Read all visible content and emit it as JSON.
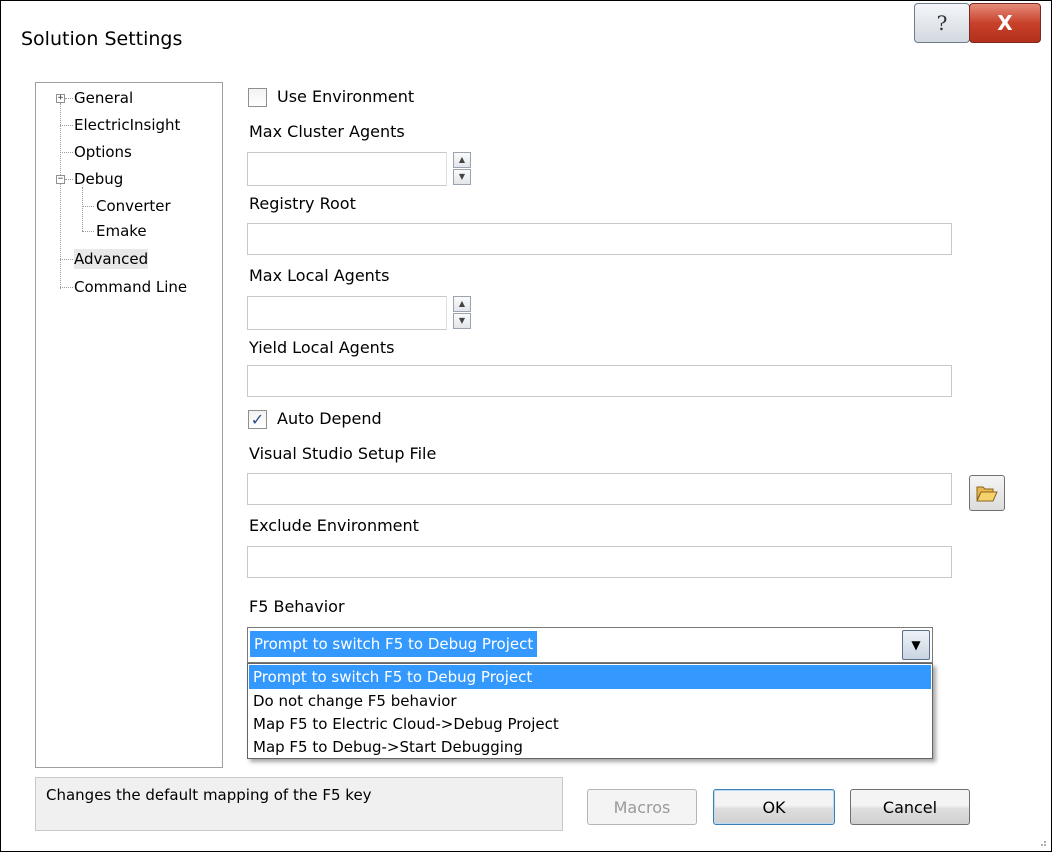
{
  "window": {
    "title": "Solution Settings",
    "help_glyph": "?",
    "close_glyph": "X"
  },
  "tree": {
    "items": [
      {
        "label": "General",
        "expander": "+"
      },
      {
        "label": "ElectricInsight"
      },
      {
        "label": "Options"
      },
      {
        "label": "Debug",
        "expander": "−"
      },
      {
        "label": "Converter"
      },
      {
        "label": "Emake"
      },
      {
        "label": "Advanced",
        "selected": true
      },
      {
        "label": "Command Line"
      }
    ]
  },
  "form": {
    "use_environment": {
      "label": "Use Environment",
      "checked": false
    },
    "max_cluster_agents": {
      "label": "Max Cluster Agents",
      "value": ""
    },
    "registry_root": {
      "label": "Registry Root",
      "value": ""
    },
    "max_local_agents": {
      "label": "Max Local Agents",
      "value": ""
    },
    "yield_local_agents": {
      "label": "Yield Local Agents",
      "value": ""
    },
    "auto_depend": {
      "label": "Auto Depend",
      "checked": true,
      "check_glyph": "✓"
    },
    "vs_setup_file": {
      "label": "Visual Studio Setup File",
      "value": ""
    },
    "exclude_environment": {
      "label": "Exclude Environment",
      "value": ""
    },
    "f5_behavior": {
      "label": "F5 Behavior",
      "selected": "Prompt to switch F5 to Debug Project",
      "options": [
        "Prompt to switch F5 to Debug Project",
        "Do not change F5 behavior",
        "Map F5 to Electric Cloud->Debug Project",
        "Map F5 to Debug->Start Debugging"
      ]
    }
  },
  "status": {
    "text": "Changes the default mapping of the F5 key"
  },
  "buttons": {
    "macros": {
      "label": "Macros",
      "enabled": false
    },
    "ok": {
      "label": "OK"
    },
    "cancel": {
      "label": "Cancel"
    }
  },
  "icons": {
    "spin_up": "▲",
    "spin_down": "▼",
    "dropdown_arrow": "▼"
  },
  "colors": {
    "selection": "#3399ff",
    "close_button": "#c8412b"
  }
}
